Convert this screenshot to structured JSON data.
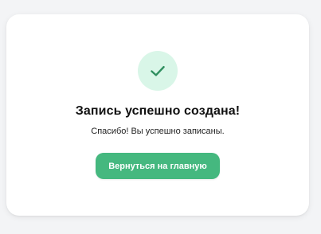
{
  "success_card": {
    "icon": "check-icon",
    "title": "Запись успешно создана!",
    "message": "Спасибо! Вы успешно записаны.",
    "button_label": "Вернуться на главную"
  },
  "colors": {
    "background": "#f3f4f6",
    "card": "#ffffff",
    "icon_circle": "#d9f6e8",
    "icon_check": "#2f8f5f",
    "button": "#45b87f",
    "button_text": "#ffffff"
  }
}
